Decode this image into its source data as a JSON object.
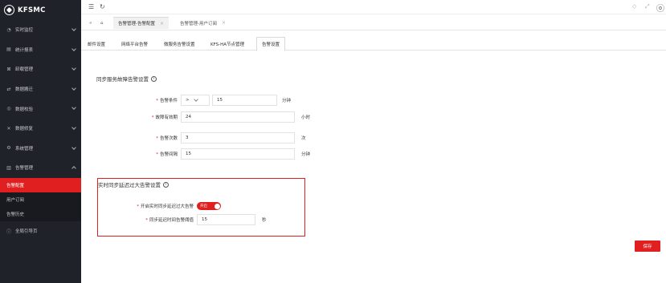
{
  "app": {
    "logo_text": "KFSMC"
  },
  "sidebar": {
    "items": [
      {
        "label": "实时监控",
        "icon": "monitor-icon"
      },
      {
        "label": "统计报表",
        "icon": "report-icon"
      },
      {
        "label": "卸载管理",
        "icon": "uninstall-icon"
      },
      {
        "label": "数据搬迁",
        "icon": "migrate-icon"
      },
      {
        "label": "数据校验",
        "icon": "verify-icon"
      },
      {
        "label": "数据修复",
        "icon": "repair-icon"
      },
      {
        "label": "系统管理",
        "icon": "gear-icon"
      },
      {
        "label": "告警管理",
        "icon": "alarm-icon"
      }
    ],
    "sub_items": [
      {
        "label": "告警配置"
      },
      {
        "label": "用户订阅"
      },
      {
        "label": "告警历史"
      }
    ],
    "guide": {
      "label": "全局引导页",
      "icon": "guide-icon"
    }
  },
  "tabs": [
    {
      "label": "告警管理-告警配置"
    },
    {
      "label": "告警管理-用户订阅"
    }
  ],
  "subtabs": [
    {
      "label": "邮件设置"
    },
    {
      "label": "网络平台告警"
    },
    {
      "label": "微服务告警设置"
    },
    {
      "label": "KFS-HA节点管理"
    },
    {
      "label": "告警设置"
    }
  ],
  "section1": {
    "title": "同步服务故障告警设置",
    "condition": {
      "label": "告警条件",
      "operator": ">",
      "value": "15",
      "unit": "分钟"
    },
    "validity": {
      "label": "故障有效期",
      "value": "24",
      "unit": "小时"
    },
    "count": {
      "label": "告警次数",
      "value": "3",
      "unit": "次"
    },
    "interval": {
      "label": "告警间隔",
      "value": "15",
      "unit": "分钟"
    }
  },
  "section2": {
    "title": "实时同步延迟过大告警设置",
    "toggle": {
      "label": "开启实时同步延迟过大告警",
      "state_label": "开启",
      "on": true
    },
    "threshold": {
      "label": "同步延迟时间告警阈值",
      "value": "15",
      "unit": "秒"
    }
  },
  "actions": {
    "save_label": "保存"
  },
  "colors": {
    "accent": "#e02020",
    "sidebar_bg": "#20222a"
  }
}
